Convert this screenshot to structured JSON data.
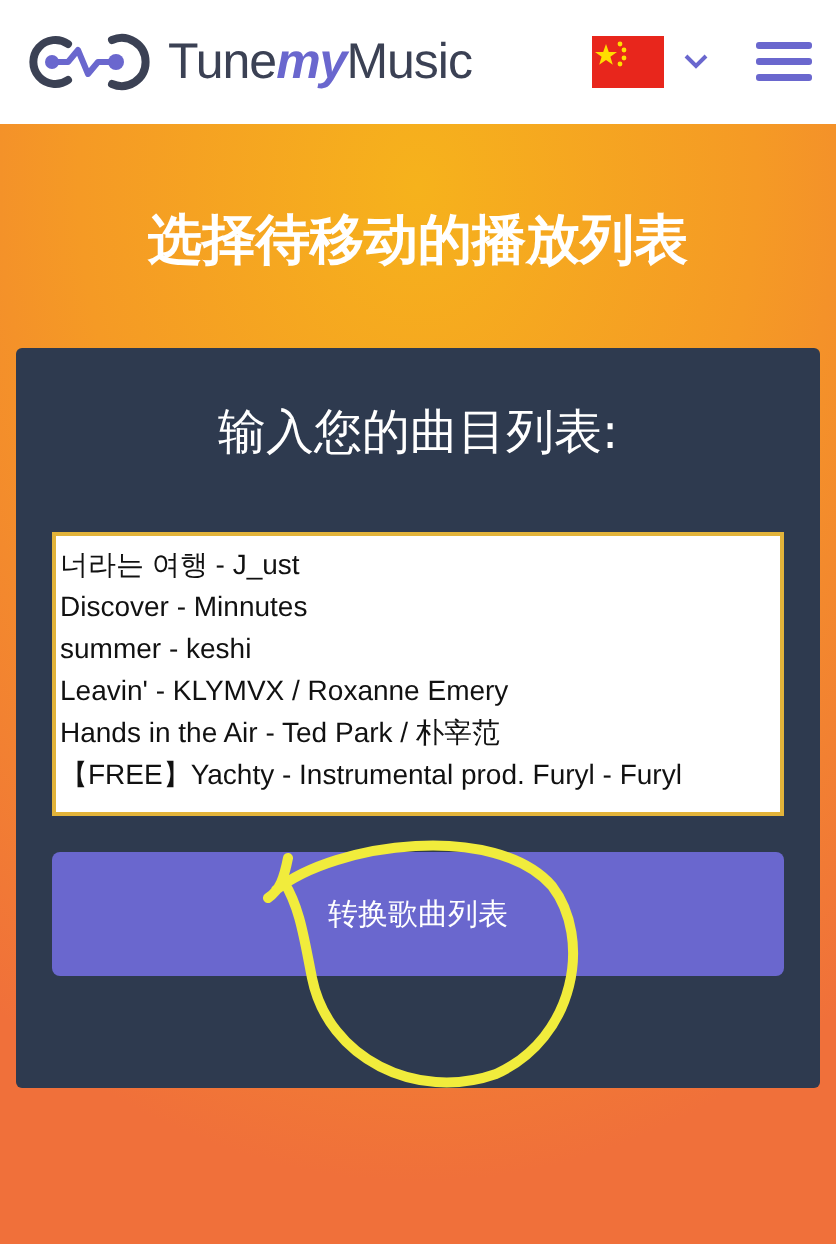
{
  "header": {
    "logo": [
      {
        "text": "Tune",
        "kind": "plain"
      },
      {
        "text": "my",
        "kind": "accent"
      },
      {
        "text": "Music",
        "kind": "plain"
      }
    ]
  },
  "title": "选择待移动的播放列表",
  "card": {
    "heading": "输入您的曲目列表:",
    "tracks": [
      "너라는 여행 - J_ust",
      "Discover - Minnutes",
      "summer - keshi",
      "Leavin' - KLYMVX / Roxanne Emery",
      "Hands in the Air - Ted Park / 朴宰范",
      "【FREE】Yachty - Instrumental prod. Furyl - Furyl"
    ],
    "button": "转换歌曲列表"
  }
}
